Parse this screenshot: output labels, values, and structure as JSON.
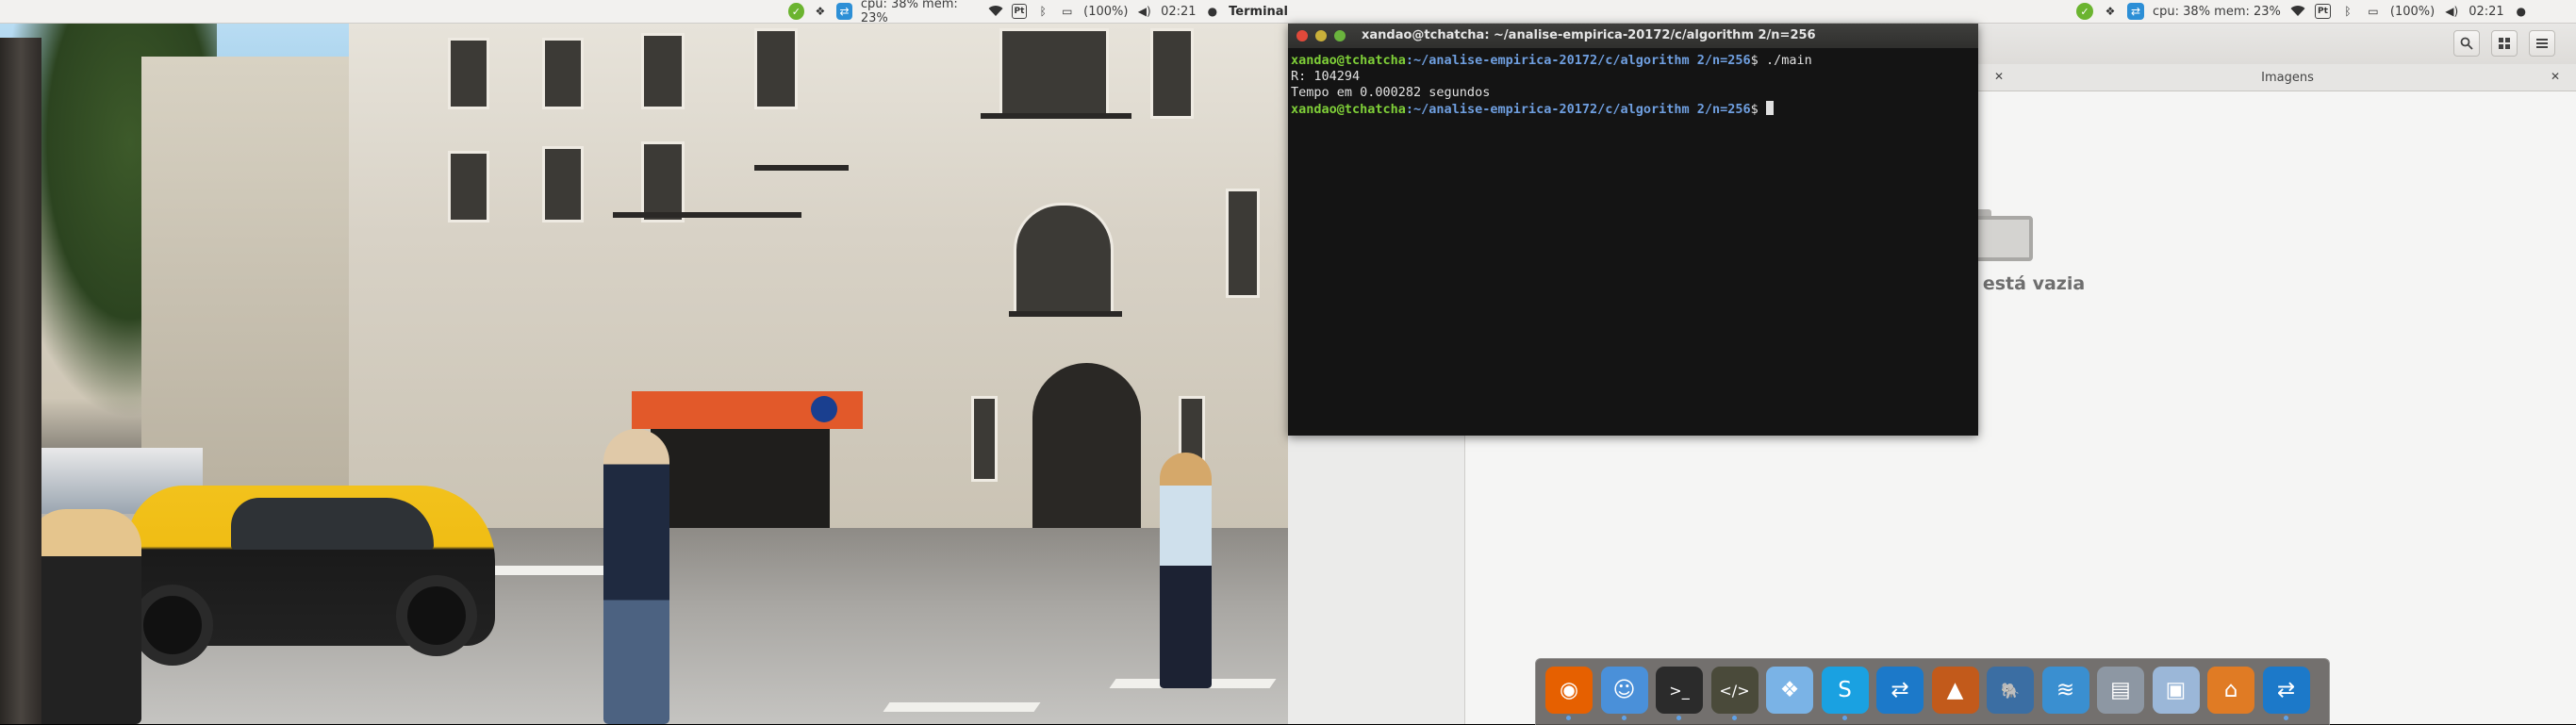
{
  "topbar_left": {
    "app_name": "Terminal",
    "system_monitor": "cpu: 38% mem: 23%",
    "keyboard_layout": "Pt",
    "battery": "(100%)",
    "clock": "02:21"
  },
  "topbar_right": {
    "system_monitor": "cpu: 38% mem: 23%",
    "keyboard_layout": "Pt",
    "battery": "(100%)",
    "clock": "02:21"
  },
  "terminal": {
    "title": "xandao@tchatcha: ~/analise-empirica-20172/c/algorithm 2/n=256",
    "prompt_user": "xandao@tchatcha",
    "prompt_path": ":~/analise-empirica-20172/c/algorithm 2/n=256",
    "prompt_symbol": "$ ",
    "command": "./main",
    "output_line1": "R: 104294",
    "output_line2": "Tempo em 0.000282 segundos"
  },
  "file_manager": {
    "tab_label": "Imagens",
    "tab_close_left": "✕",
    "tab_close_right": "✕",
    "empty_message": "Pasta está vazia"
  },
  "dock": {
    "items": [
      {
        "icon": "firefox-icon",
        "color": "#e66000"
      },
      {
        "icon": "finder-icon",
        "color": "#4a90d9"
      },
      {
        "icon": "terminal-icon",
        "color": "#2b2b2b"
      },
      {
        "icon": "code-editor-icon",
        "color": "#4a4a3a"
      },
      {
        "icon": "dropbox-icon",
        "color": "#7ab3e6"
      },
      {
        "icon": "skype-icon",
        "color": "#1aa1e1"
      },
      {
        "icon": "teamviewer-icon",
        "color": "#1c79c9"
      },
      {
        "icon": "matlab-icon",
        "color": "#c25a1b"
      },
      {
        "icon": "postgresql-icon",
        "color": "#3b6ea3"
      },
      {
        "icon": "mysql-workbench-icon",
        "color": "#3a8fd0"
      },
      {
        "icon": "scanner-icon",
        "color": "#8d97a3"
      },
      {
        "icon": "virtualbox-icon",
        "color": "#9bb7d8"
      },
      {
        "icon": "network-app-icon",
        "color": "#e07b24"
      },
      {
        "icon": "teamviewer-2-icon",
        "color": "#1c79c9"
      }
    ]
  }
}
